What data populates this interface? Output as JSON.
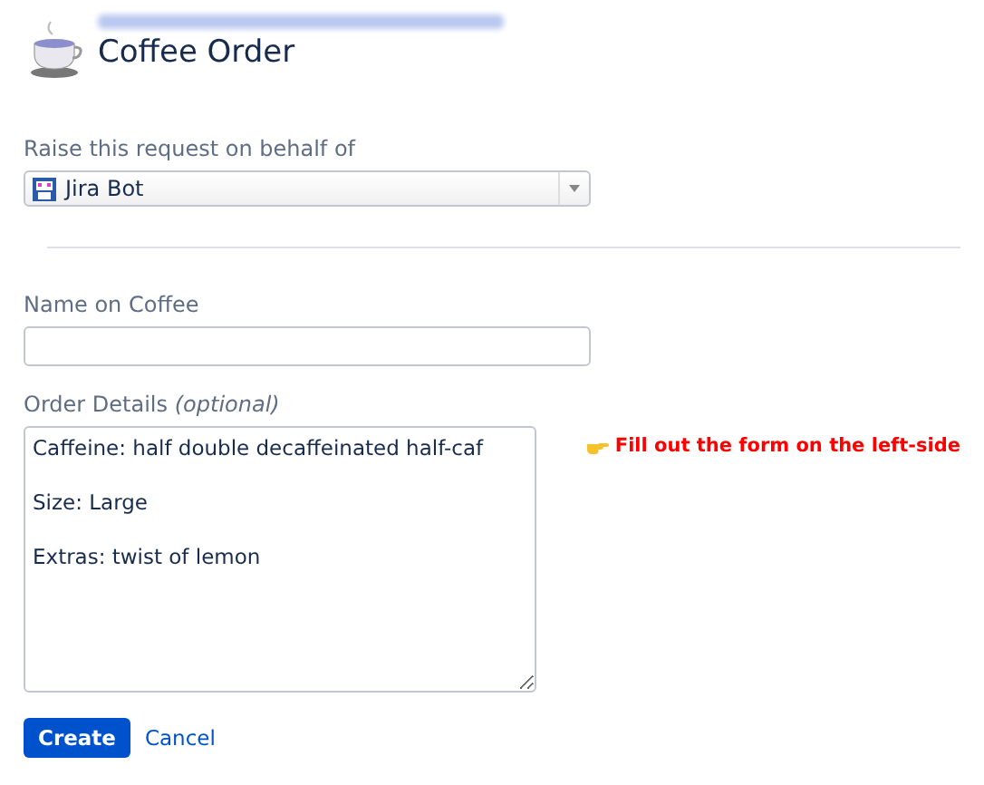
{
  "header": {
    "title": "Coffee Order"
  },
  "fields": [
    {
      "kind": "select",
      "label": "Raise this request on behalf of",
      "value": "Jira Bot"
    },
    {
      "kind": "text",
      "label": "Name on Coffee"
    },
    {
      "kind": "textarea",
      "label": "Order Details",
      "label_note": "(optional)",
      "value": "Caffeine: half double decaffeinated half-caf\n\nSize: Large\n\nExtras: twist of lemon"
    }
  ],
  "hint": "Fill out the form on the left-side",
  "buttons": [
    {
      "label": "Create",
      "kind": "primary"
    },
    {
      "label": "Cancel",
      "kind": "link"
    }
  ]
}
